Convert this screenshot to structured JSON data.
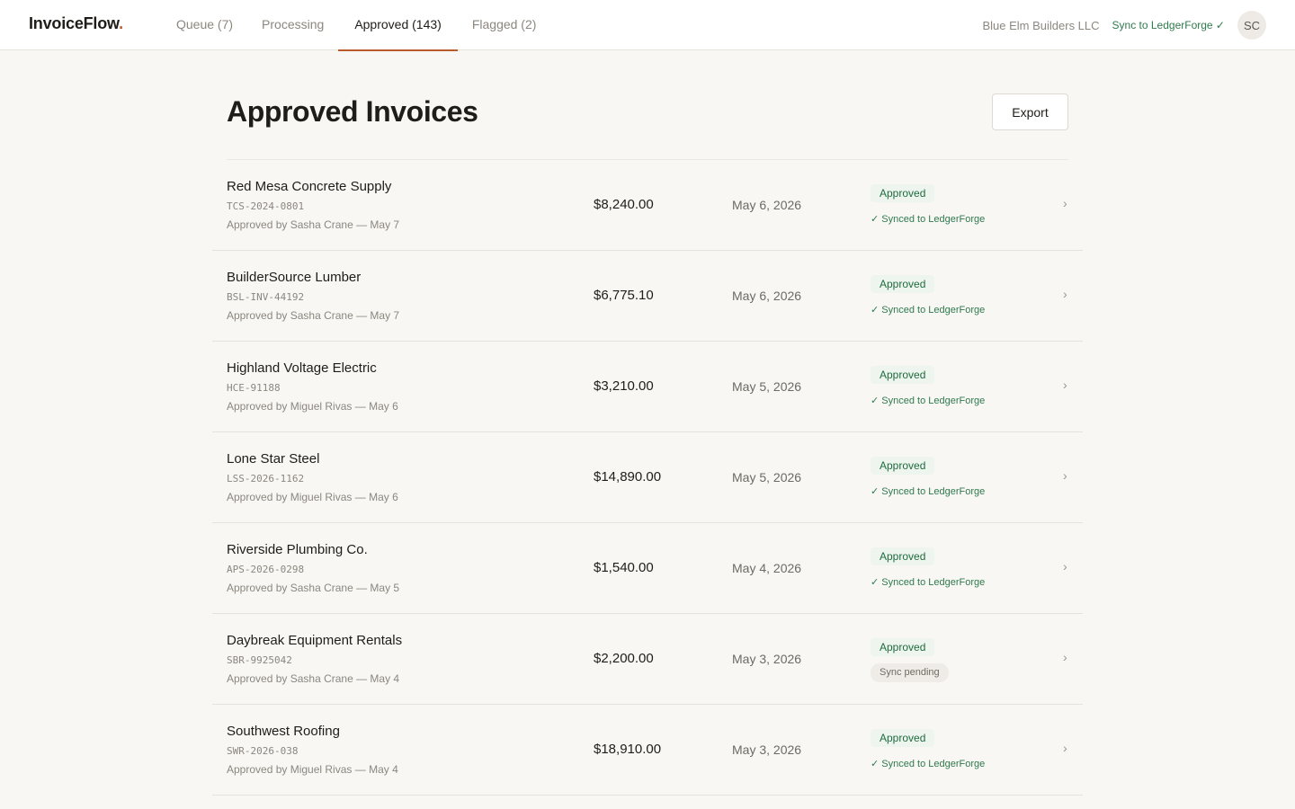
{
  "app": {
    "logo_text": "InvoiceFlow",
    "logo_dot": ".",
    "company": "Blue Elm Builders LLC",
    "sync_link": "Sync to LedgerForge ✓",
    "avatar_initials": "SC"
  },
  "tabs": [
    {
      "label": "Queue (7)",
      "active": false
    },
    {
      "label": "Processing",
      "active": false
    },
    {
      "label": "Approved (143)",
      "active": true
    },
    {
      "label": "Flagged (2)",
      "active": false
    }
  ],
  "page": {
    "title": "Approved Invoices",
    "export_label": "Export"
  },
  "invoices": [
    {
      "vendor": "Red Mesa Concrete Supply",
      "invoice_no": "TCS-2024-0801",
      "approved_by": "Approved by Sasha Crane — May 7",
      "amount": "$8,240.00",
      "date": "May 6, 2026",
      "status": "Approved",
      "sync": "✓ Synced to LedgerForge",
      "sync_pending": false,
      "chevron": "›"
    },
    {
      "vendor": "BuilderSource Lumber",
      "invoice_no": "BSL-INV-44192",
      "approved_by": "Approved by Sasha Crane — May 7",
      "amount": "$6,775.10",
      "date": "May 6, 2026",
      "status": "Approved",
      "sync": "✓ Synced to LedgerForge",
      "sync_pending": false,
      "chevron": "›"
    },
    {
      "vendor": "Highland Voltage Electric",
      "invoice_no": "HCE-91188",
      "approved_by": "Approved by Miguel Rivas — May 6",
      "amount": "$3,210.00",
      "date": "May 5, 2026",
      "status": "Approved",
      "sync": "✓ Synced to LedgerForge",
      "sync_pending": false,
      "chevron": "›"
    },
    {
      "vendor": "Lone Star Steel",
      "invoice_no": "LSS-2026-1162",
      "approved_by": "Approved by Miguel Rivas — May 6",
      "amount": "$14,890.00",
      "date": "May 5, 2026",
      "status": "Approved",
      "sync": "✓ Synced to LedgerForge",
      "sync_pending": false,
      "chevron": "›"
    },
    {
      "vendor": "Riverside Plumbing Co.",
      "invoice_no": "APS-2026-0298",
      "approved_by": "Approved by Sasha Crane — May 5",
      "amount": "$1,540.00",
      "date": "May 4, 2026",
      "status": "Approved",
      "sync": "✓ Synced to LedgerForge",
      "sync_pending": false,
      "chevron": "›"
    },
    {
      "vendor": "Daybreak Equipment Rentals",
      "invoice_no": "SBR-9925042",
      "approved_by": "Approved by Sasha Crane — May 4",
      "amount": "$2,200.00",
      "date": "May 3, 2026",
      "status": "Approved",
      "sync": "Sync pending",
      "sync_pending": true,
      "chevron": "›"
    },
    {
      "vendor": "Southwest Roofing",
      "invoice_no": "SWR-2026-038",
      "approved_by": "Approved by Miguel Rivas — May 4",
      "amount": "$18,910.00",
      "date": "May 3, 2026",
      "status": "Approved",
      "sync": "✓ Synced to LedgerForge",
      "sync_pending": false,
      "chevron": "›"
    }
  ]
}
